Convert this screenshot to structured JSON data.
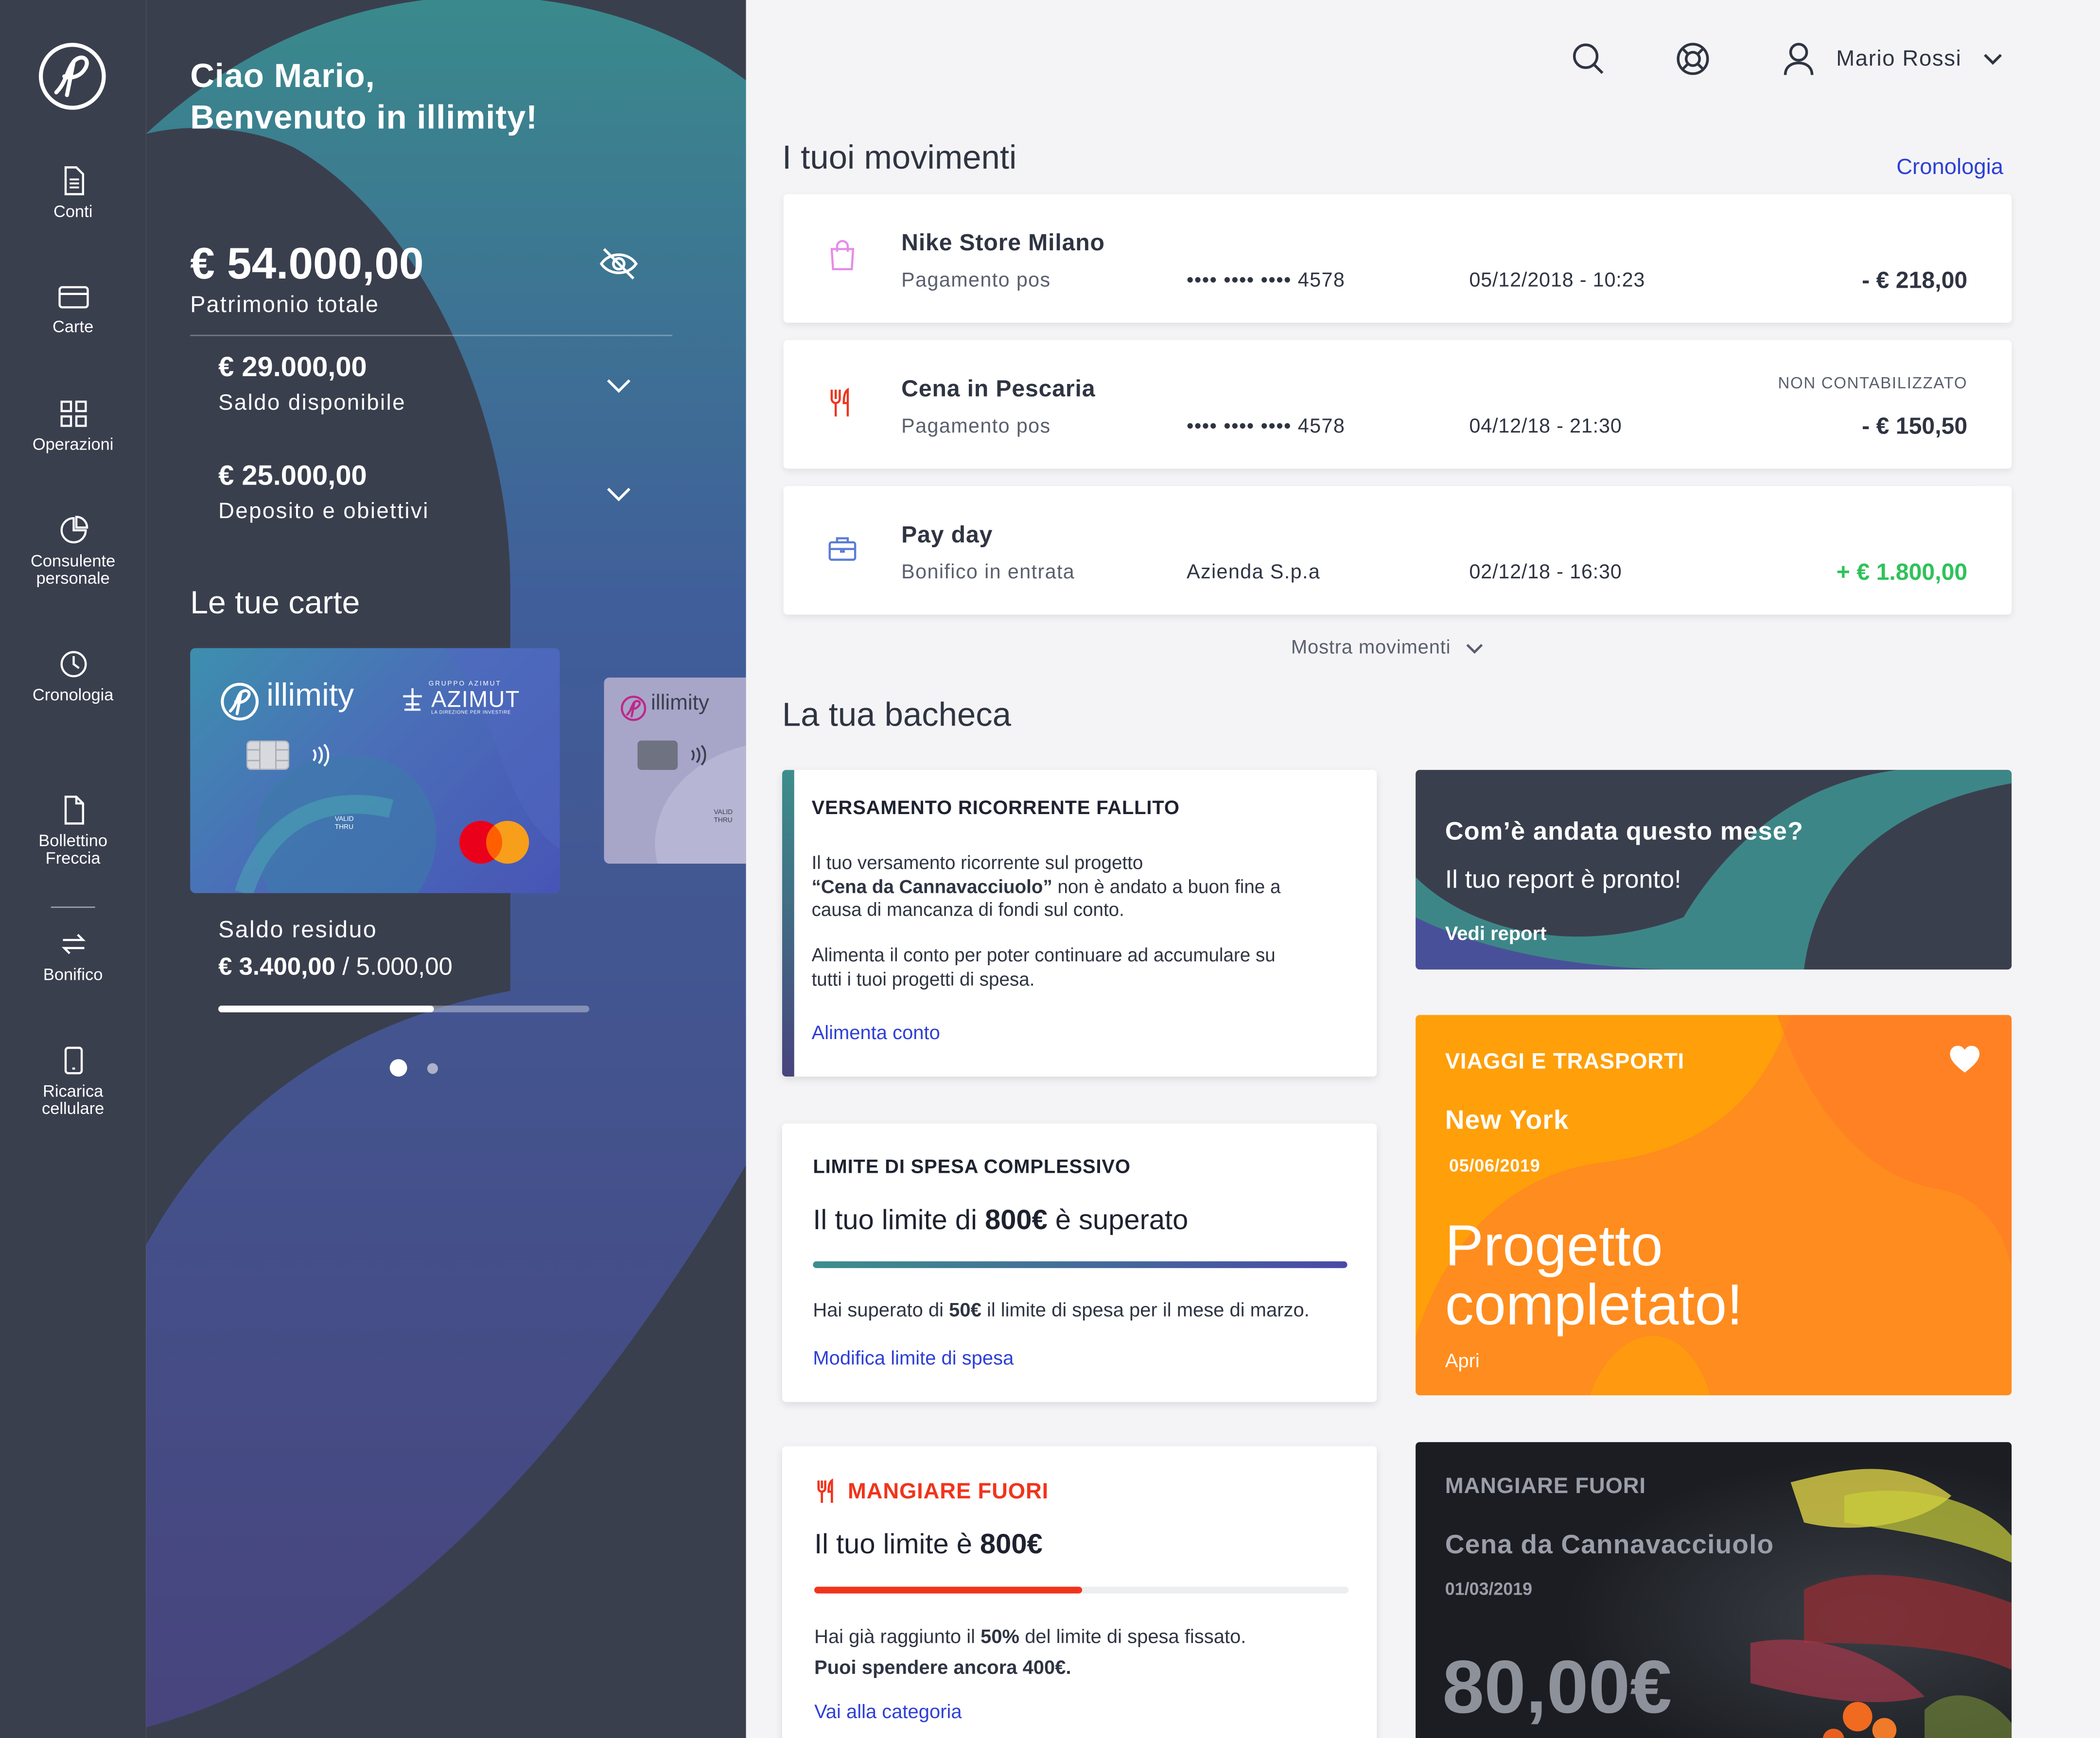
{
  "nav": {
    "items": [
      {
        "label": "Conti",
        "icon": "document-icon"
      },
      {
        "label": "Carte",
        "icon": "card-icon"
      },
      {
        "label": "Operazioni",
        "icon": "grid-icon"
      },
      {
        "label_line1": "Consulente",
        "label_line2": "personale",
        "icon": "pie-chart-icon"
      },
      {
        "label": "Cronologia",
        "icon": "clock-icon"
      },
      {
        "label_line1": "Bollettino",
        "label_line2": "Freccia",
        "icon": "file-icon"
      },
      {
        "label": "Bonifico",
        "icon": "transfer-icon"
      },
      {
        "label_line1": "Ricarica",
        "label_line2": "cellulare",
        "icon": "phone-icon"
      }
    ]
  },
  "hero": {
    "greeting_line1": "Ciao Mario,",
    "greeting_line2": "Benvenuto in illimity!",
    "total_amount": "€ 54.000,00",
    "total_label": "Patrimonio totale",
    "accounts": [
      {
        "amount": "€ 29.000,00",
        "label": "Saldo disponibile"
      },
      {
        "amount": "€ 25.000,00",
        "label": "Deposito e obiettivi"
      }
    ],
    "cards_title": "Le tue carte",
    "card": {
      "brand": "illimity",
      "partner_small": "GRUPPO AZIMUT",
      "partner": "AZIMUT",
      "partner_tagline": "LA DIREZIONE PER INVESTIRE",
      "valid_line1": "VALID",
      "valid_line2": "THRU"
    },
    "residual_label": "Saldo residuo",
    "residual_value": "€ 3.400,00",
    "residual_limit": " / 5.000,00",
    "residual_progress": 0.58,
    "carousel_active": 0
  },
  "topbar": {
    "user_name": "Mario Rossi"
  },
  "movements": {
    "title": "I tuoi movimenti",
    "history_link": "Cronologia",
    "show_more": "Mostra movimenti",
    "items": [
      {
        "title": "Nike Store Milano",
        "subtitle": "Pagamento pos",
        "counterpart": "•••• •••• •••• 4578",
        "date": "05/12/2018 - 10:23",
        "amount": "- € 218,00",
        "status": "",
        "icon": "shopping-bag-icon"
      },
      {
        "title": "Cena in Pescaria",
        "subtitle": "Pagamento pos",
        "counterpart": "•••• •••• •••• 4578",
        "date": "04/12/18 - 21:30",
        "amount": "- € 150,50",
        "status": "NON CONTABILIZZATO",
        "icon": "cutlery-icon"
      },
      {
        "title": "Pay day",
        "subtitle": "Bonifico in entrata",
        "counterpart": "Azienda S.p.a",
        "date": "02/12/18 - 16:30",
        "amount": "+ € 1.800,00",
        "status": "",
        "icon": "briefcase-icon"
      }
    ]
  },
  "board": {
    "title": "La tua bacheca",
    "failed": {
      "title": "VERSAMENTO RICORRENTE FALLITO",
      "text_1": "Il tuo versamento ricorrente sul progetto",
      "text_bold": "“Cena da Cannavacciuolo”",
      "text_2": " non è andato a buon fine a",
      "text_3": "causa di mancanza di fondi sul conto.",
      "text_4": "Alimenta il conto per poter continuare ad accumulare su",
      "text_5": "tutti i tuoi progetti di spesa.",
      "link": "Alimenta conto"
    },
    "limit": {
      "title": "LIMITE DI SPESA COMPLESSIVO",
      "headline_pre": "Il tuo limite di ",
      "headline_bold": "800€",
      "headline_post": " è superato",
      "text_pre": "Hai superato di ",
      "text_bold": "50€",
      "text_post": " il limite di spesa per il mese di marzo.",
      "link": "Modifica limite di spesa",
      "progress": 1.0
    },
    "dining": {
      "title": "MANGIARE FUORI",
      "headline_pre": "Il tuo limite è ",
      "headline_bold": "800€",
      "text_pre": "Hai già raggiunto il ",
      "text_bold": "50%",
      "text_post": " del limite di spesa fissato.",
      "text_line2": "Puoi spendere ancora 400€.",
      "link": "Vai alla categoria",
      "progress": 0.5,
      "accent": "#f0341c"
    },
    "report": {
      "title": "Com’è andata questo mese?",
      "subtitle": "Il tuo report è pronto!",
      "link": "Vedi report"
    },
    "travel": {
      "category": "VIAGGI E TRASPORTI",
      "place": "New York",
      "date": "05/06/2019",
      "headline_1": "Progetto",
      "headline_2": "completato!",
      "link": "Apri",
      "accent": "#ff8a1f"
    },
    "dinner_project": {
      "category": "MANGIARE FUORI",
      "name": "Cena da Cannavacciuolo",
      "date": "01/03/2019",
      "amount": "80,00€"
    }
  }
}
